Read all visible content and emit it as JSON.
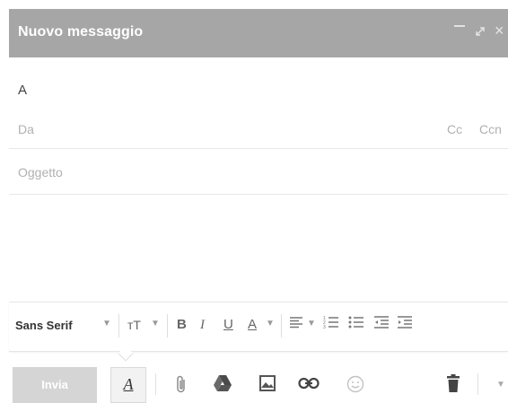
{
  "window": {
    "title": "Nuovo messaggio",
    "minimize_icon": "minimize-icon",
    "expand_icon": "expand-icon",
    "close_icon": "close-icon",
    "close_glyph": "×"
  },
  "recipients": {
    "to_label": "A",
    "from_label": "Da",
    "cc_label": "Cc",
    "ccn_label": "Ccn"
  },
  "subject": {
    "placeholder": "Oggetto"
  },
  "format_toolbar": {
    "font_family": "Sans Serif",
    "size_icon": "text-size-icon",
    "size_glyph": "ᴛT",
    "bold": "B",
    "italic": "I",
    "underline": "U",
    "text_color": "A",
    "align_icon": "align-icon",
    "numbered_list_icon": "numbered-list-icon",
    "bulleted_list_icon": "bulleted-list-icon",
    "indent_less_icon": "indent-less-icon",
    "indent_more_icon": "indent-more-icon"
  },
  "actions": {
    "send": "Invia",
    "formatting_toggle": "A",
    "attach_icon": "paperclip-icon",
    "drive_icon": "drive-icon",
    "photo_icon": "photo-icon",
    "link_icon": "link-icon",
    "emoji_icon": "emoji-icon",
    "trash_icon": "trash-icon",
    "more_icon": "chevron-down-icon"
  },
  "colors": {
    "titlebar": "#a6a6a6",
    "send_button": "#d5d5d5"
  }
}
